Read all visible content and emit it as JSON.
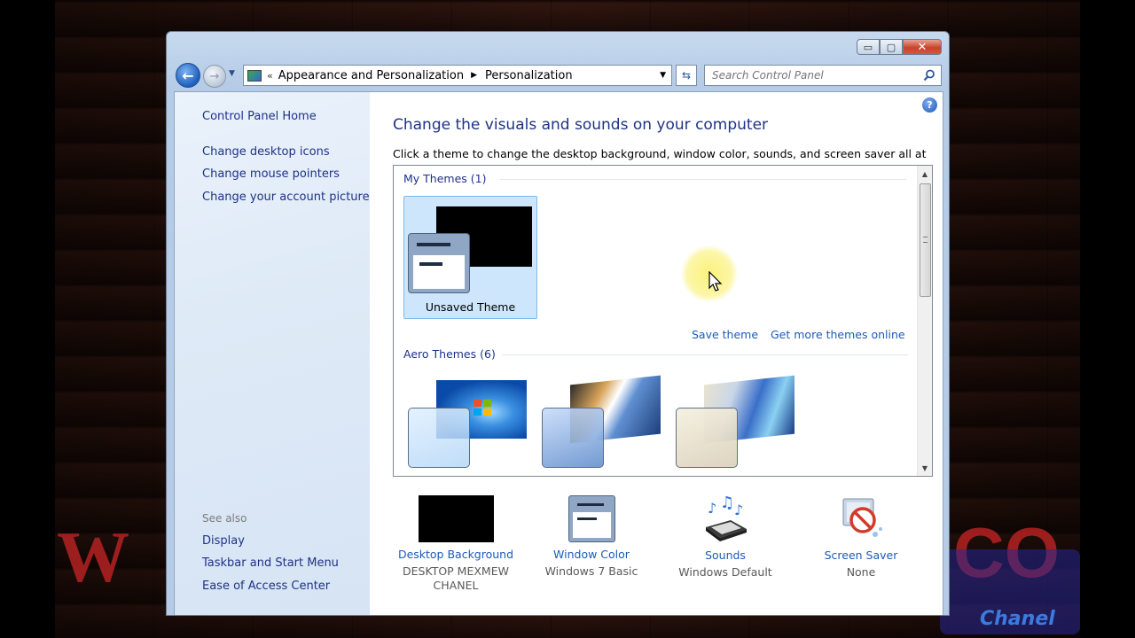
{
  "window": {
    "caption": {
      "minimize": "▭",
      "maximize": "▢",
      "close": "✕"
    }
  },
  "nav": {
    "breadcrumbs": [
      "Appearance and Personalization",
      "Personalization"
    ],
    "search_placeholder": "Search Control Panel"
  },
  "sidebar": {
    "home_link": "Control Panel Home",
    "task_links": [
      "Change desktop icons",
      "Change mouse pointers",
      "Change your account picture"
    ],
    "see_also_label": "See also",
    "see_also_links": [
      "Display",
      "Taskbar and Start Menu",
      "Ease of Access Center"
    ]
  },
  "main": {
    "title": "Change the visuals and sounds on your computer",
    "description": "Click a theme to change the desktop background, window color, sounds, and screen saver all at once.",
    "groups": {
      "my_themes": "My Themes (1)",
      "aero_themes": "Aero Themes (6)"
    },
    "selected_theme": "Unsaved Theme",
    "save_theme_link": "Save theme",
    "get_more_link": "Get more themes online",
    "bottom_items": [
      {
        "link": "Desktop Background",
        "value": "DESKTOP MEXMEW CHANEL",
        "icon": "desktop-background-icon"
      },
      {
        "link": "Window Color",
        "value": "Windows 7 Basic",
        "icon": "window-color-icon"
      },
      {
        "link": "Sounds",
        "value": "Windows Default",
        "icon": "sounds-icon"
      },
      {
        "link": "Screen Saver",
        "value": "None",
        "icon": "screen-saver-icon"
      }
    ]
  },
  "overlay": {
    "watermark_left": "W",
    "watermark_right": "CO",
    "logo_text": "Chanel"
  },
  "colors": {
    "link": "#1e5bb8",
    "heading": "#1e3287",
    "selection": "#cde6fb"
  }
}
